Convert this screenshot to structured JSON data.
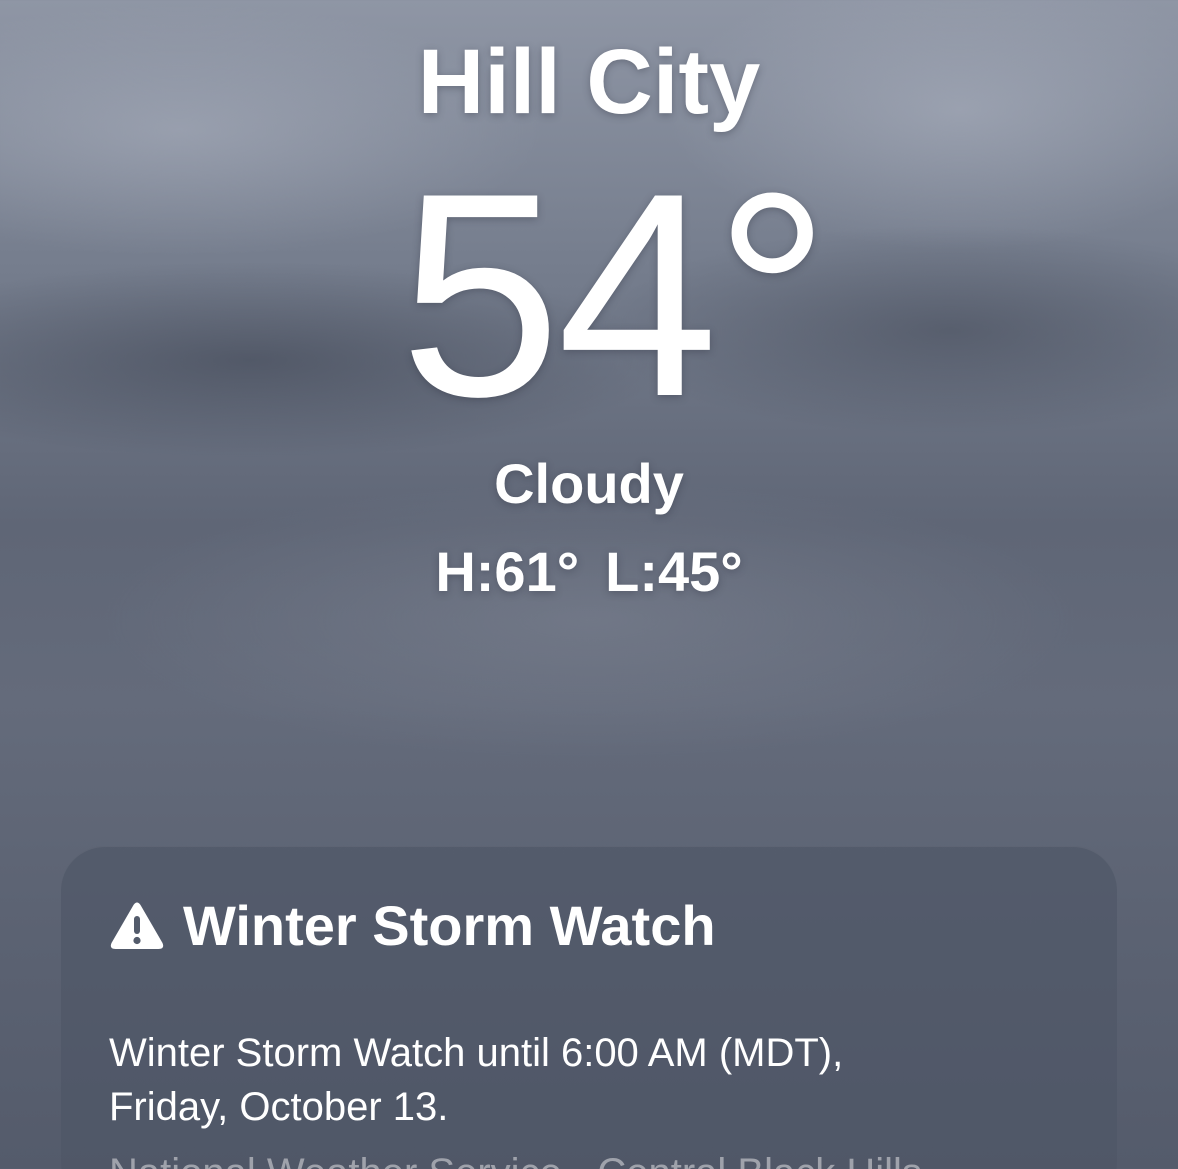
{
  "location": {
    "city": "Hill City",
    "temperature": "54°",
    "condition": "Cloudy",
    "high": "H:61°",
    "low": "L:45°"
  },
  "alert": {
    "icon": "warning-triangle-icon",
    "title": "Winter Storm Watch",
    "body_line1": "Winter Storm Watch until 6:00 AM (MDT),",
    "body_line2": "Friday, October 13.",
    "source": "National Weather Service · Central Black Hills"
  }
}
